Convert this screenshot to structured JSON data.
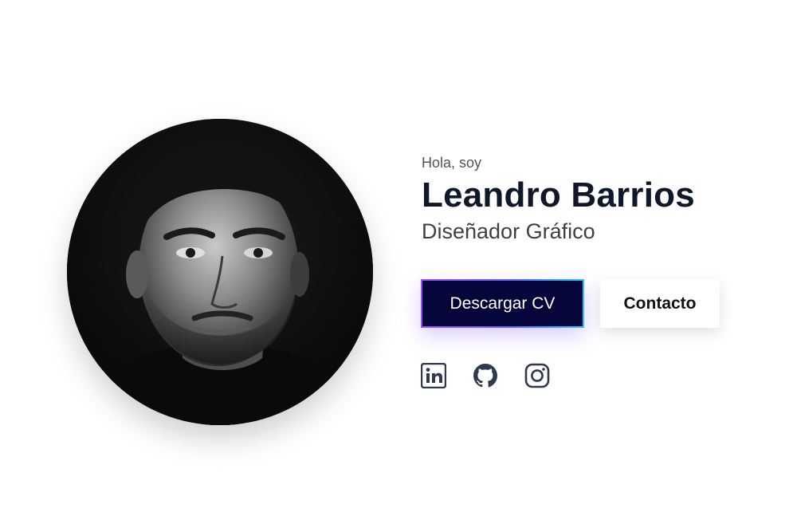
{
  "hero": {
    "greeting": "Hola, soy",
    "name": "Leandro Barrios",
    "role": "Diseñador Gráfico",
    "primary_button": "Descargar CV",
    "secondary_button": "Contacto"
  },
  "socials": [
    {
      "icon": "linkedin-icon"
    },
    {
      "icon": "github-icon"
    },
    {
      "icon": "instagram-icon"
    }
  ],
  "colors": {
    "heading": "#0f172a",
    "primary_button_bg": "#07063b",
    "gradient_start": "#9b4dff",
    "gradient_end": "#1fc6ff",
    "icon": "#2e3a4e"
  }
}
